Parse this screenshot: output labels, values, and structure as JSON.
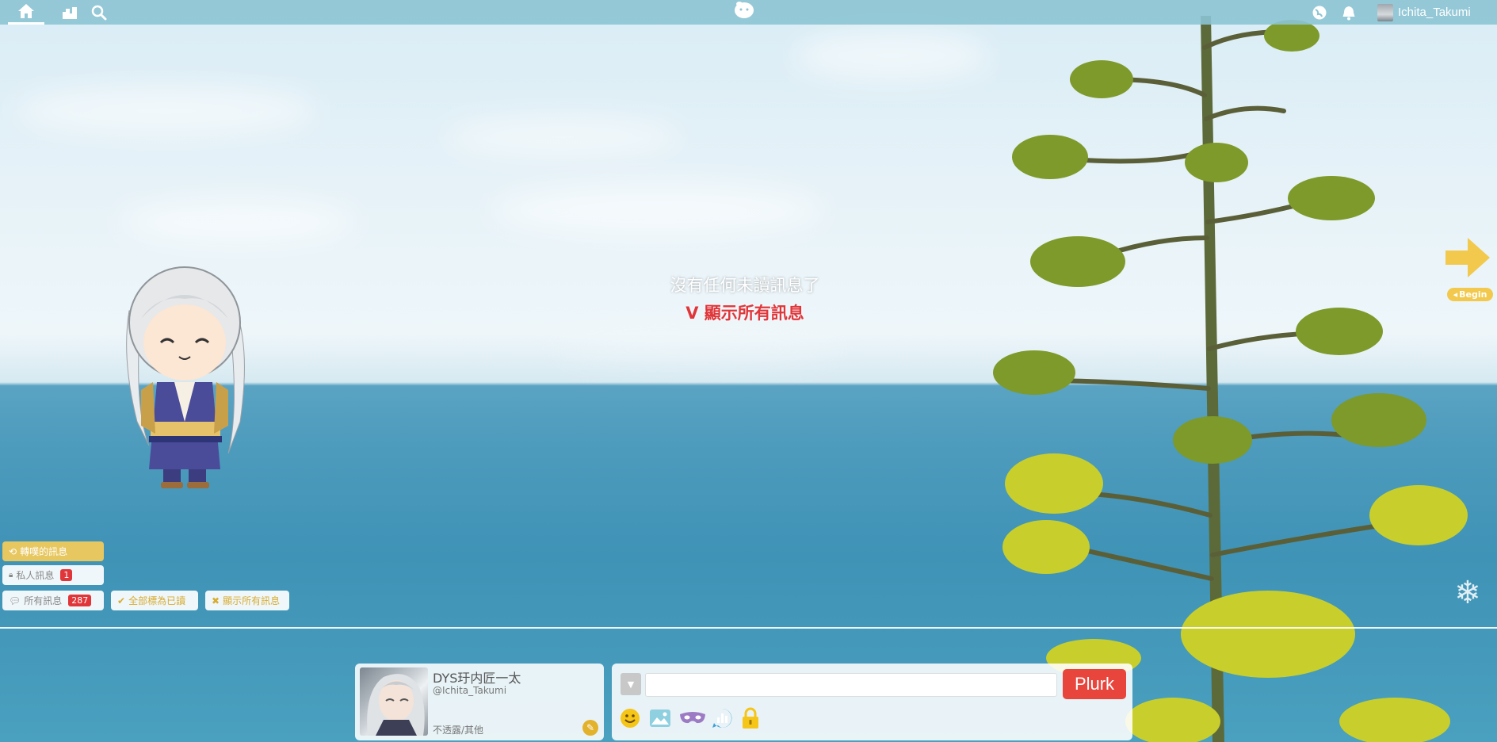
{
  "topbar": {
    "user_name": "Ichita_Takumi"
  },
  "timeline": {
    "empty_message": "沒有任何未讀訊息了",
    "show_all_link": "V 顯示所有訊息",
    "begin_label": "Begin"
  },
  "filters": {
    "replurked": "轉噗的訊息",
    "private": "私人訊息",
    "private_count": "1",
    "all": "所有訊息",
    "all_count": "287",
    "mark_all_read": "全部標為已讀",
    "show_all": "顯示所有訊息"
  },
  "profile": {
    "display_name": "DYS玗内匠一太",
    "handle": "@Ichita_Takumi",
    "karma_label": "不透露/其他"
  },
  "composer": {
    "qualifier_value": "▼",
    "input_value": "",
    "submit_label": "Plurk"
  },
  "colors": {
    "accent_gold": "#e7c75f",
    "badge_red": "#e0363a",
    "plurk_button": "#e8453c",
    "topbar": "#8cc4d4"
  }
}
